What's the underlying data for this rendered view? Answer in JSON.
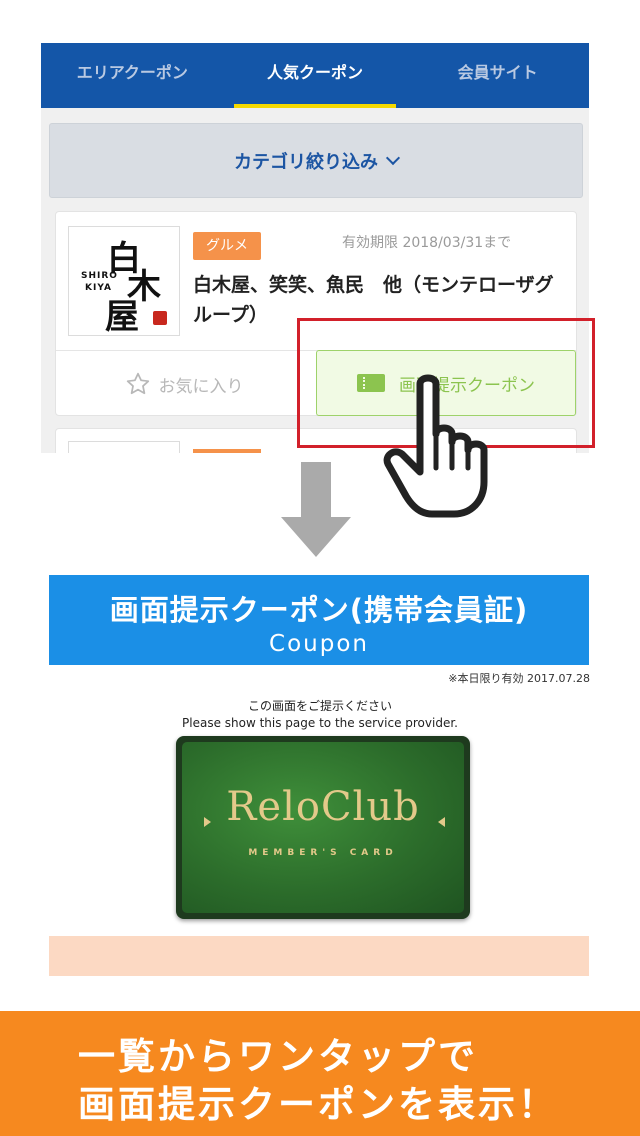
{
  "tabs": [
    {
      "label": "エリアクーポン",
      "active": false
    },
    {
      "label": "人気クーポン",
      "active": true
    },
    {
      "label": "会員サイト",
      "active": false
    }
  ],
  "category_filter": {
    "label": "カテゴリ絞り込み"
  },
  "coupon_card": {
    "logo": {
      "line1": "白",
      "line2": "木",
      "line3": "屋",
      "small1": "SHIRO",
      "small2": "KIYA"
    },
    "category_badge": "グルメ",
    "expiry": "有効期限 2018/03/31まで",
    "shop_name": "白木屋、笑笑、魚民　他（モンテローザグループ）",
    "favorite_label": "お気に入り",
    "coupon_button_label": "画面提示クーポン"
  },
  "coupon_screen": {
    "title": "画面提示クーポン(携帯会員証)",
    "subtitle": "Coupon",
    "validity": "※本日限り有効 2017.07.28",
    "prompt_ja": "この画面をご提示ください",
    "prompt_en": "Please show this page to the service provider.",
    "card_logo": "ReloClub",
    "card_subtitle": "MEMBER'S CARD"
  },
  "caption": {
    "line1": "一覧からワンタップで",
    "line2": "画面提示クーポンを表示！"
  },
  "colors": {
    "tabbar": "#1456a8",
    "tab_indicator": "#f5d900",
    "badge": "#f5924a",
    "coupon_green": "#8cc44f",
    "highlight_red": "#d2202a",
    "coupon_banner": "#1b8fe6",
    "caption_orange": "#f6891f"
  }
}
